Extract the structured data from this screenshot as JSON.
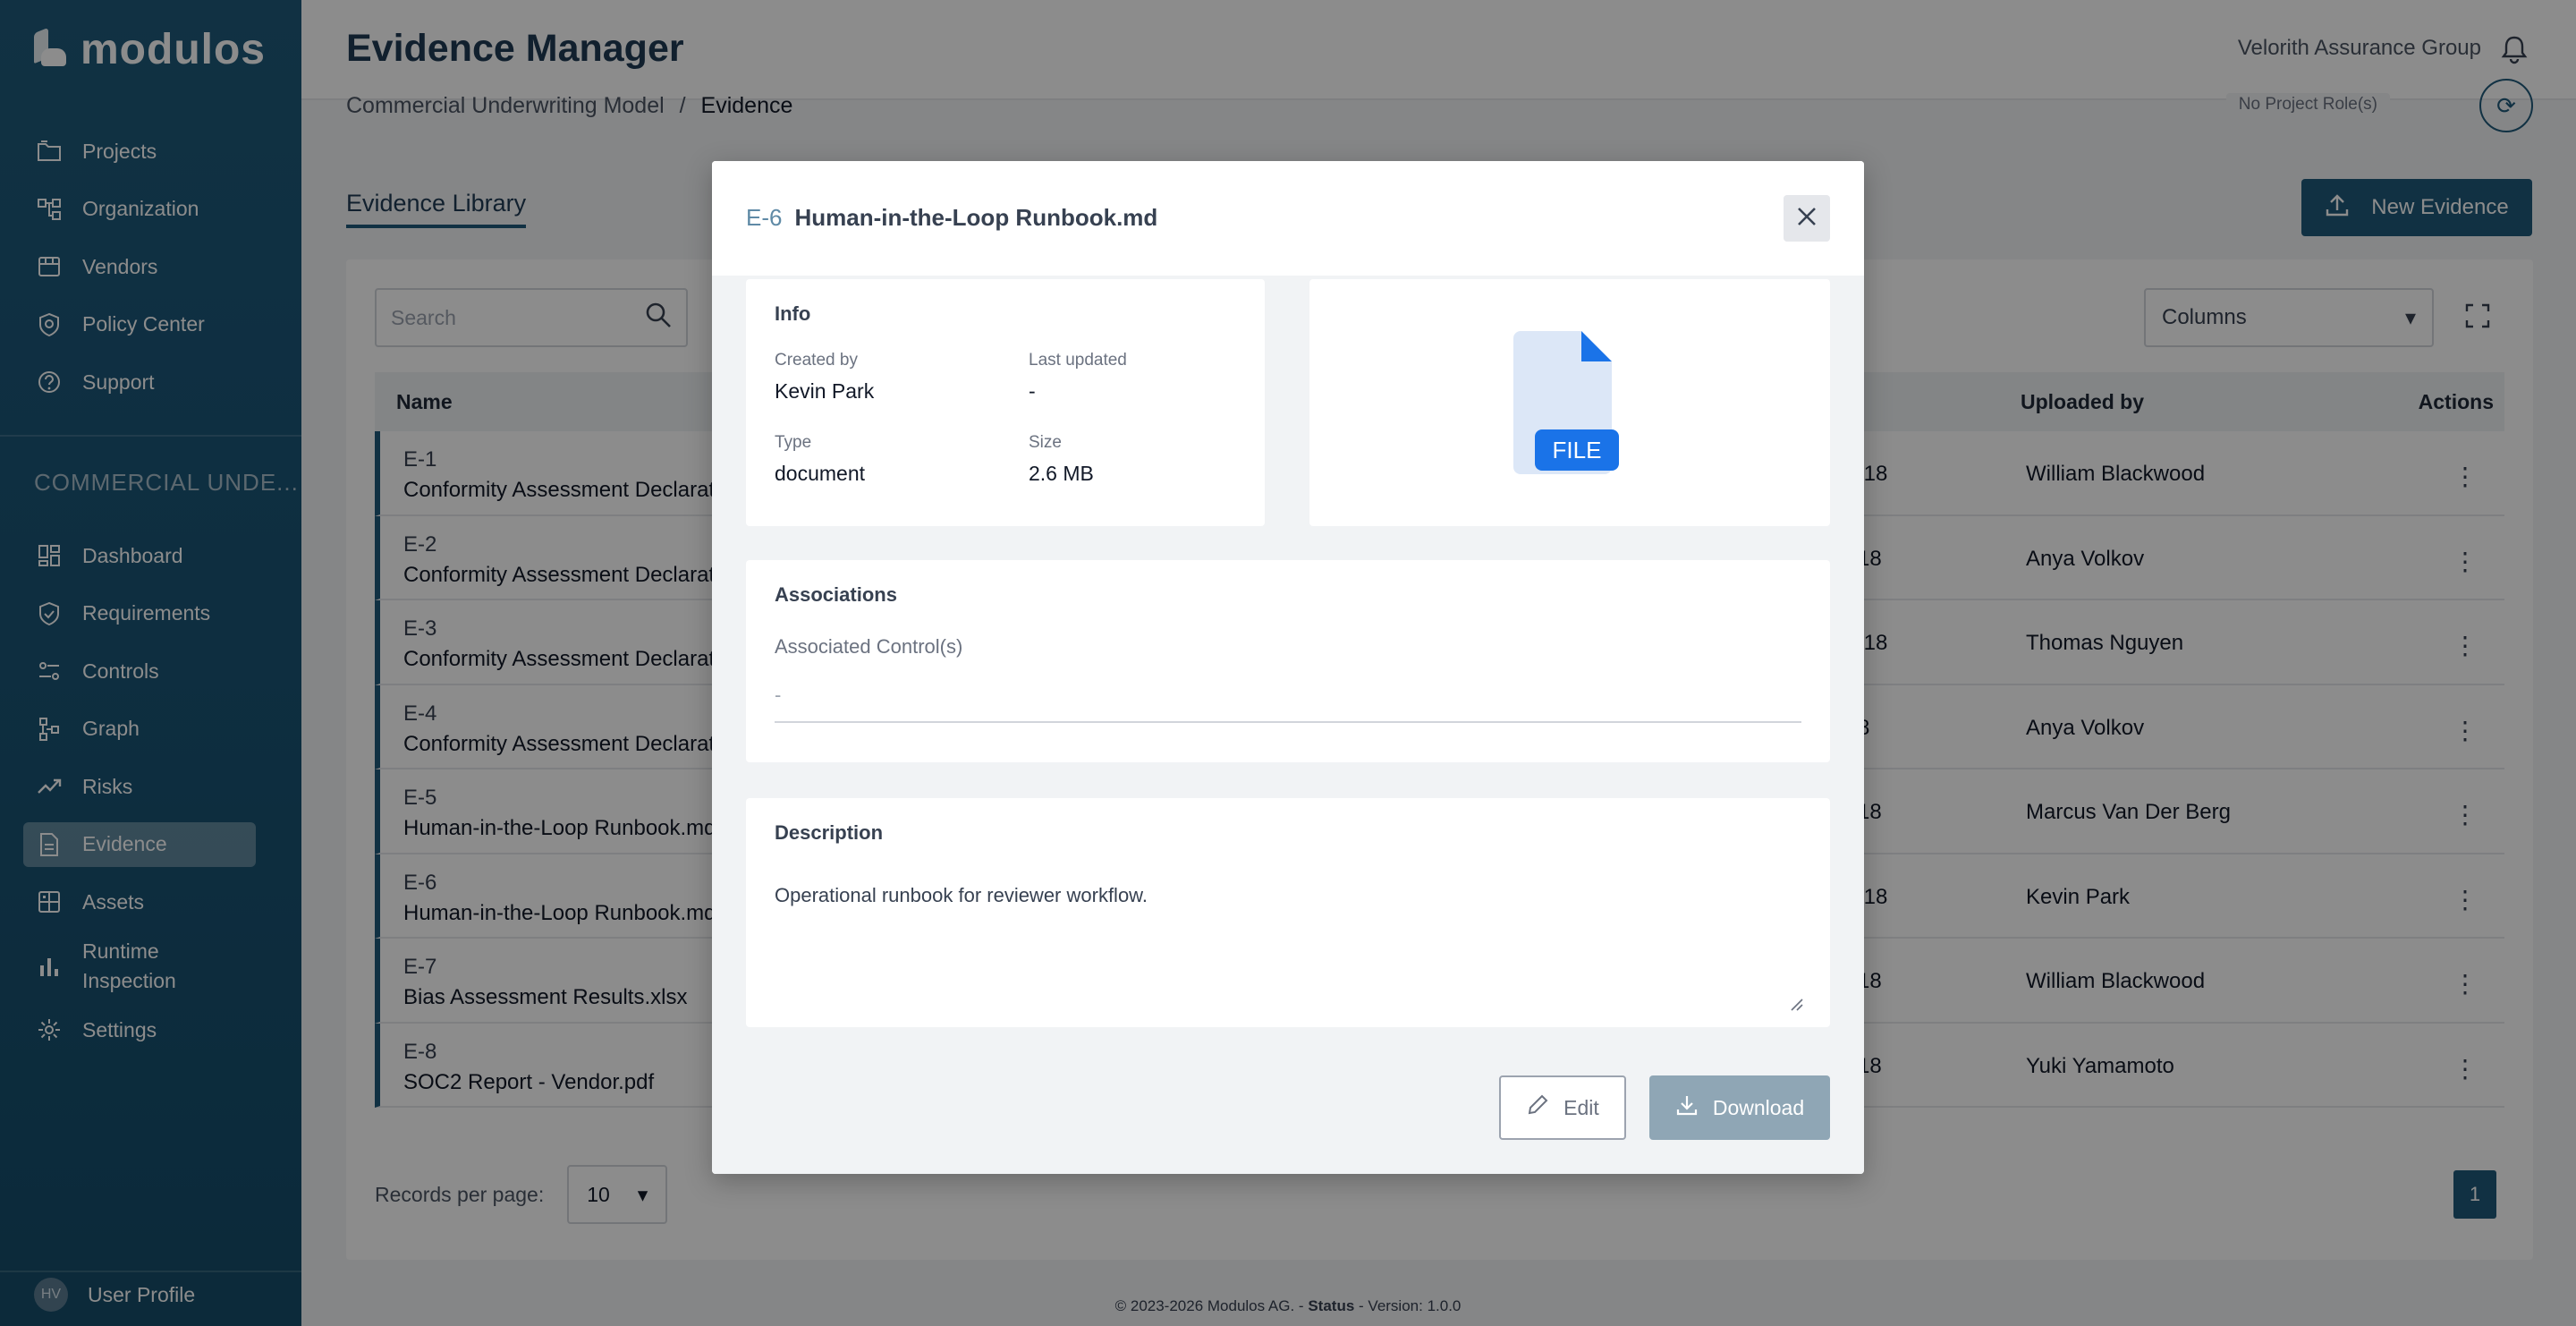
{
  "app": {
    "logo_text": "modulos",
    "page_title": "Evidence Manager",
    "org_name": "Velorith Assurance Group"
  },
  "sidebar": {
    "top_items": [
      {
        "label": "Projects",
        "icon": "folder-icon"
      },
      {
        "label": "Organization",
        "icon": "org-chart-icon"
      },
      {
        "label": "Vendors",
        "icon": "store-icon"
      },
      {
        "label": "Policy Center",
        "icon": "shield-icon"
      },
      {
        "label": "Support",
        "icon": "help-circle-icon"
      }
    ],
    "section_title": "COMMERCIAL UNDE...",
    "project_items": [
      {
        "label": "Dashboard",
        "icon": "dashboard-icon",
        "active": false
      },
      {
        "label": "Requirements",
        "icon": "shield-check-icon",
        "active": false
      },
      {
        "label": "Controls",
        "icon": "controls-icon",
        "active": false
      },
      {
        "label": "Graph",
        "icon": "graph-icon",
        "active": false
      },
      {
        "label": "Risks",
        "icon": "trend-icon",
        "active": false
      },
      {
        "label": "Evidence",
        "icon": "document-icon",
        "active": true
      },
      {
        "label": "Assets",
        "icon": "grid-icon",
        "active": false
      },
      {
        "label": "Runtime Inspection",
        "icon": "bar-chart-icon",
        "active": false
      },
      {
        "label": "Settings",
        "icon": "gear-icon",
        "active": false
      }
    ],
    "user_initials": "HV",
    "user_profile_label": "User Profile"
  },
  "breadcrumb": {
    "parent": "Commercial Underwriting Model",
    "separator": "/",
    "current": "Evidence"
  },
  "role_chip": "No Project Role(s)",
  "tab_label": "Evidence Library",
  "new_evidence_label": "New Evidence",
  "search": {
    "placeholder": "Search"
  },
  "columns_label": "Columns",
  "table": {
    "headers": {
      "name": "Name",
      "uploaded_by": "Uploaded by",
      "actions": "Actions"
    },
    "rows": [
      {
        "id": "E-1",
        "name": "Conformity Assessment Declarat",
        "time_frag": ":18",
        "uploaded_by": "William Blackwood"
      },
      {
        "id": "E-2",
        "name": "Conformity Assessment Declarat",
        "time_frag": "18",
        "uploaded_by": "Anya Volkov"
      },
      {
        "id": "E-3",
        "name": "Conformity Assessment Declarat",
        "time_frag": ":18",
        "uploaded_by": "Thomas Nguyen"
      },
      {
        "id": "E-4",
        "name": "Conformity Assessment Declarat",
        "time_frag": "8",
        "uploaded_by": "Anya Volkov"
      },
      {
        "id": "E-5",
        "name": "Human-in-the-Loop Runbook.md",
        "time_frag": "18",
        "uploaded_by": "Marcus Van Der Berg"
      },
      {
        "id": "E-6",
        "name": "Human-in-the-Loop Runbook.md",
        "time_frag": ":18",
        "uploaded_by": "Kevin Park"
      },
      {
        "id": "E-7",
        "name": "Bias Assessment Results.xlsx",
        "time_frag": "18",
        "uploaded_by": "William Blackwood"
      },
      {
        "id": "E-8",
        "name": "SOC2 Report - Vendor.pdf",
        "time_frag": "18",
        "uploaded_by": "Yuki Yamamoto"
      }
    ]
  },
  "pagination": {
    "records_label": "Records per page:",
    "per_page": "10",
    "current_page": "1"
  },
  "footer": {
    "copyright": "© 2023-2026 Modulos AG. -",
    "status": "Status",
    "version": "- Version: 1.0.0"
  },
  "modal": {
    "id": "E-6",
    "name": "Human-in-the-Loop Runbook.md",
    "info": {
      "title": "Info",
      "created_by_label": "Created by",
      "created_by": "Kevin Park",
      "last_updated_label": "Last updated",
      "last_updated": "-",
      "type_label": "Type",
      "type": "document",
      "size_label": "Size",
      "size": "2.6 MB"
    },
    "file_badge": "FILE",
    "associations": {
      "title": "Associations",
      "controls_label": "Associated Control(s)",
      "controls_value": "-"
    },
    "description": {
      "title": "Description",
      "text": "Operational runbook for reviewer workflow."
    },
    "edit_label": "Edit",
    "download_label": "Download"
  },
  "colors": {
    "accent": "#1f5a7a",
    "file_blue": "#1a73e8",
    "download_disabled": "#8fa6b5"
  }
}
